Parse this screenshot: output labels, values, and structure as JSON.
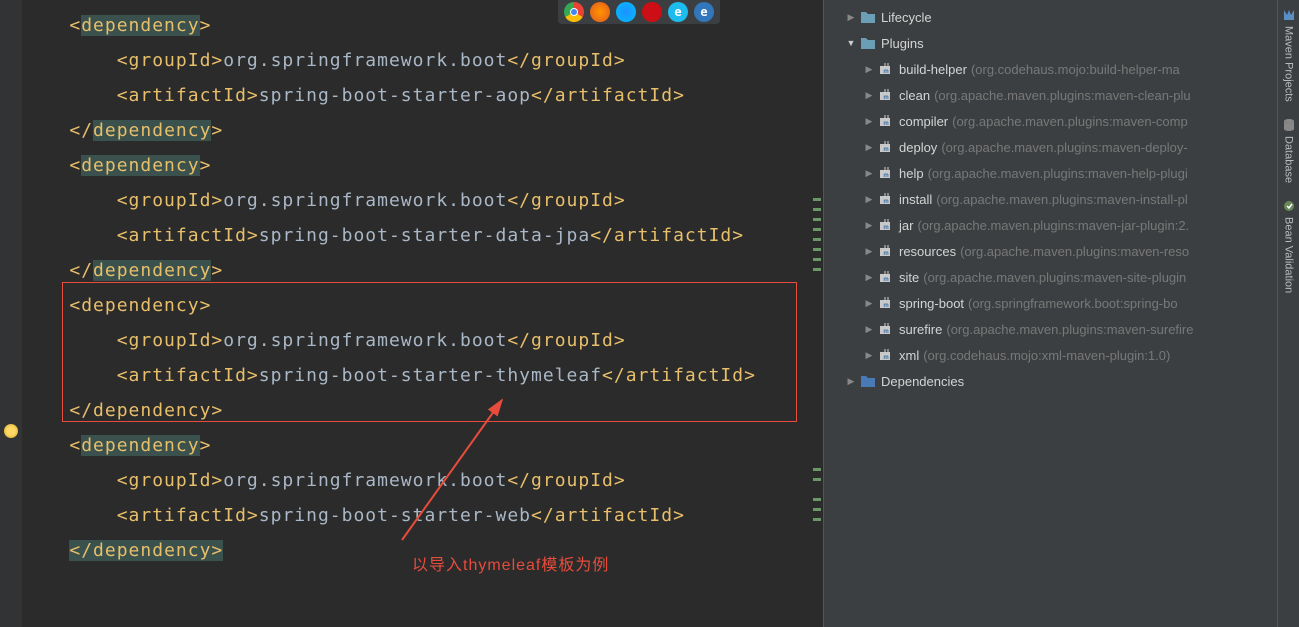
{
  "code": {
    "dependencies": [
      {
        "groupId": "org.springframework.boot",
        "artifactId": "spring-boot-starter-aop",
        "highlighted": false
      },
      {
        "groupId": "org.springframework.boot",
        "artifactId": "spring-boot-starter-data-jpa",
        "highlighted": false
      },
      {
        "groupId": "org.springframework.boot",
        "artifactId": "spring-boot-starter-thymeleaf",
        "highlighted": true
      },
      {
        "groupId": "org.springframework.boot",
        "artifactId": "spring-boot-starter-web",
        "highlighted": false
      }
    ],
    "tags": {
      "dependency_open": "dependency",
      "dependency_close": "dependency",
      "groupId_open": "groupId",
      "groupId_close": "groupId",
      "artifactId_open": "artifactId",
      "artifactId_close": "artifactId"
    }
  },
  "annotation_text": "以导入thymeleaf模板为例",
  "tree": {
    "lifecycle": {
      "label": "Lifecycle"
    },
    "plugins": {
      "label": "Plugins",
      "items": [
        {
          "name": "build-helper",
          "detail": "(org.codehaus.mojo:build-helper-ma"
        },
        {
          "name": "clean",
          "detail": "(org.apache.maven.plugins:maven-clean-plu"
        },
        {
          "name": "compiler",
          "detail": "(org.apache.maven.plugins:maven-comp"
        },
        {
          "name": "deploy",
          "detail": "(org.apache.maven.plugins:maven-deploy-"
        },
        {
          "name": "help",
          "detail": "(org.apache.maven.plugins:maven-help-plugi"
        },
        {
          "name": "install",
          "detail": "(org.apache.maven.plugins:maven-install-pl"
        },
        {
          "name": "jar",
          "detail": "(org.apache.maven.plugins:maven-jar-plugin:2."
        },
        {
          "name": "resources",
          "detail": "(org.apache.maven.plugins:maven-reso"
        },
        {
          "name": "site",
          "detail": "(org.apache.maven.plugins:maven-site-plugin"
        },
        {
          "name": "spring-boot",
          "detail": "(org.springframework.boot:spring-bo"
        },
        {
          "name": "surefire",
          "detail": "(org.apache.maven.plugins:maven-surefire"
        },
        {
          "name": "xml",
          "detail": "(org.codehaus.mojo:xml-maven-plugin:1.0)"
        }
      ]
    },
    "dependencies": {
      "label": "Dependencies"
    }
  },
  "side_tabs": {
    "maven": "Maven Projects",
    "database": "Database",
    "bean": "Bean Validation"
  }
}
